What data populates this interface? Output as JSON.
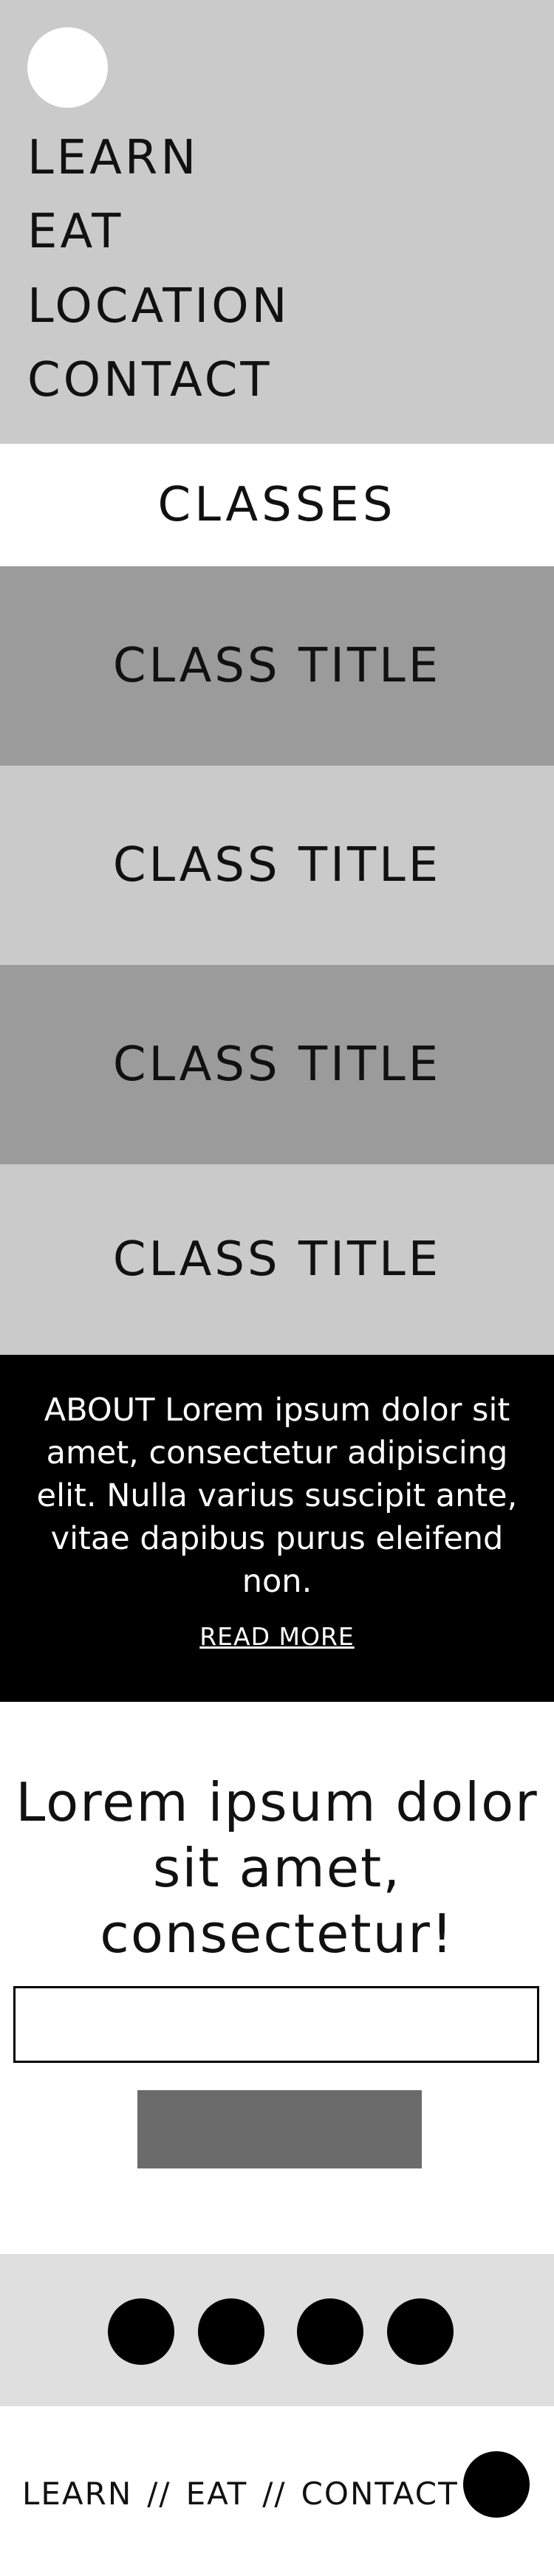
{
  "nav": {
    "items": [
      {
        "label": "LEARN"
      },
      {
        "label": "EAT"
      },
      {
        "label": "LOCATION"
      },
      {
        "label": "CONTACT"
      }
    ]
  },
  "classes": {
    "heading": "CLASSES",
    "items": [
      {
        "title": "CLASS TITLE"
      },
      {
        "title": "CLASS TITLE"
      },
      {
        "title": "CLASS TITLE"
      },
      {
        "title": "CLASS TITLE"
      }
    ]
  },
  "about": {
    "text": "ABOUT Lorem ipsum dolor sit amet, consectetur adipiscing elit. Nulla varius suscipit ante, vitae dapibus purus eleifend non.",
    "link_label": "READ MORE"
  },
  "signup": {
    "title": "Lorem ipsum dolor sit amet, consectetur!",
    "input_value": "",
    "button_label": ""
  },
  "social": {
    "icons": [
      "social-icon-1",
      "social-icon-2",
      "social-icon-3",
      "social-icon-4"
    ]
  },
  "footer": {
    "links": [
      {
        "label": "LEARN"
      },
      {
        "label": "EAT"
      },
      {
        "label": "CONTACT"
      }
    ],
    "separator": "//"
  },
  "colors": {
    "header_bg": "#cacaca",
    "card_dark": "#9b9b9b",
    "card_light": "#cacaca",
    "about_bg": "#000000",
    "button_bg": "#6b6b6b",
    "social_bg": "#dfdfdf"
  }
}
